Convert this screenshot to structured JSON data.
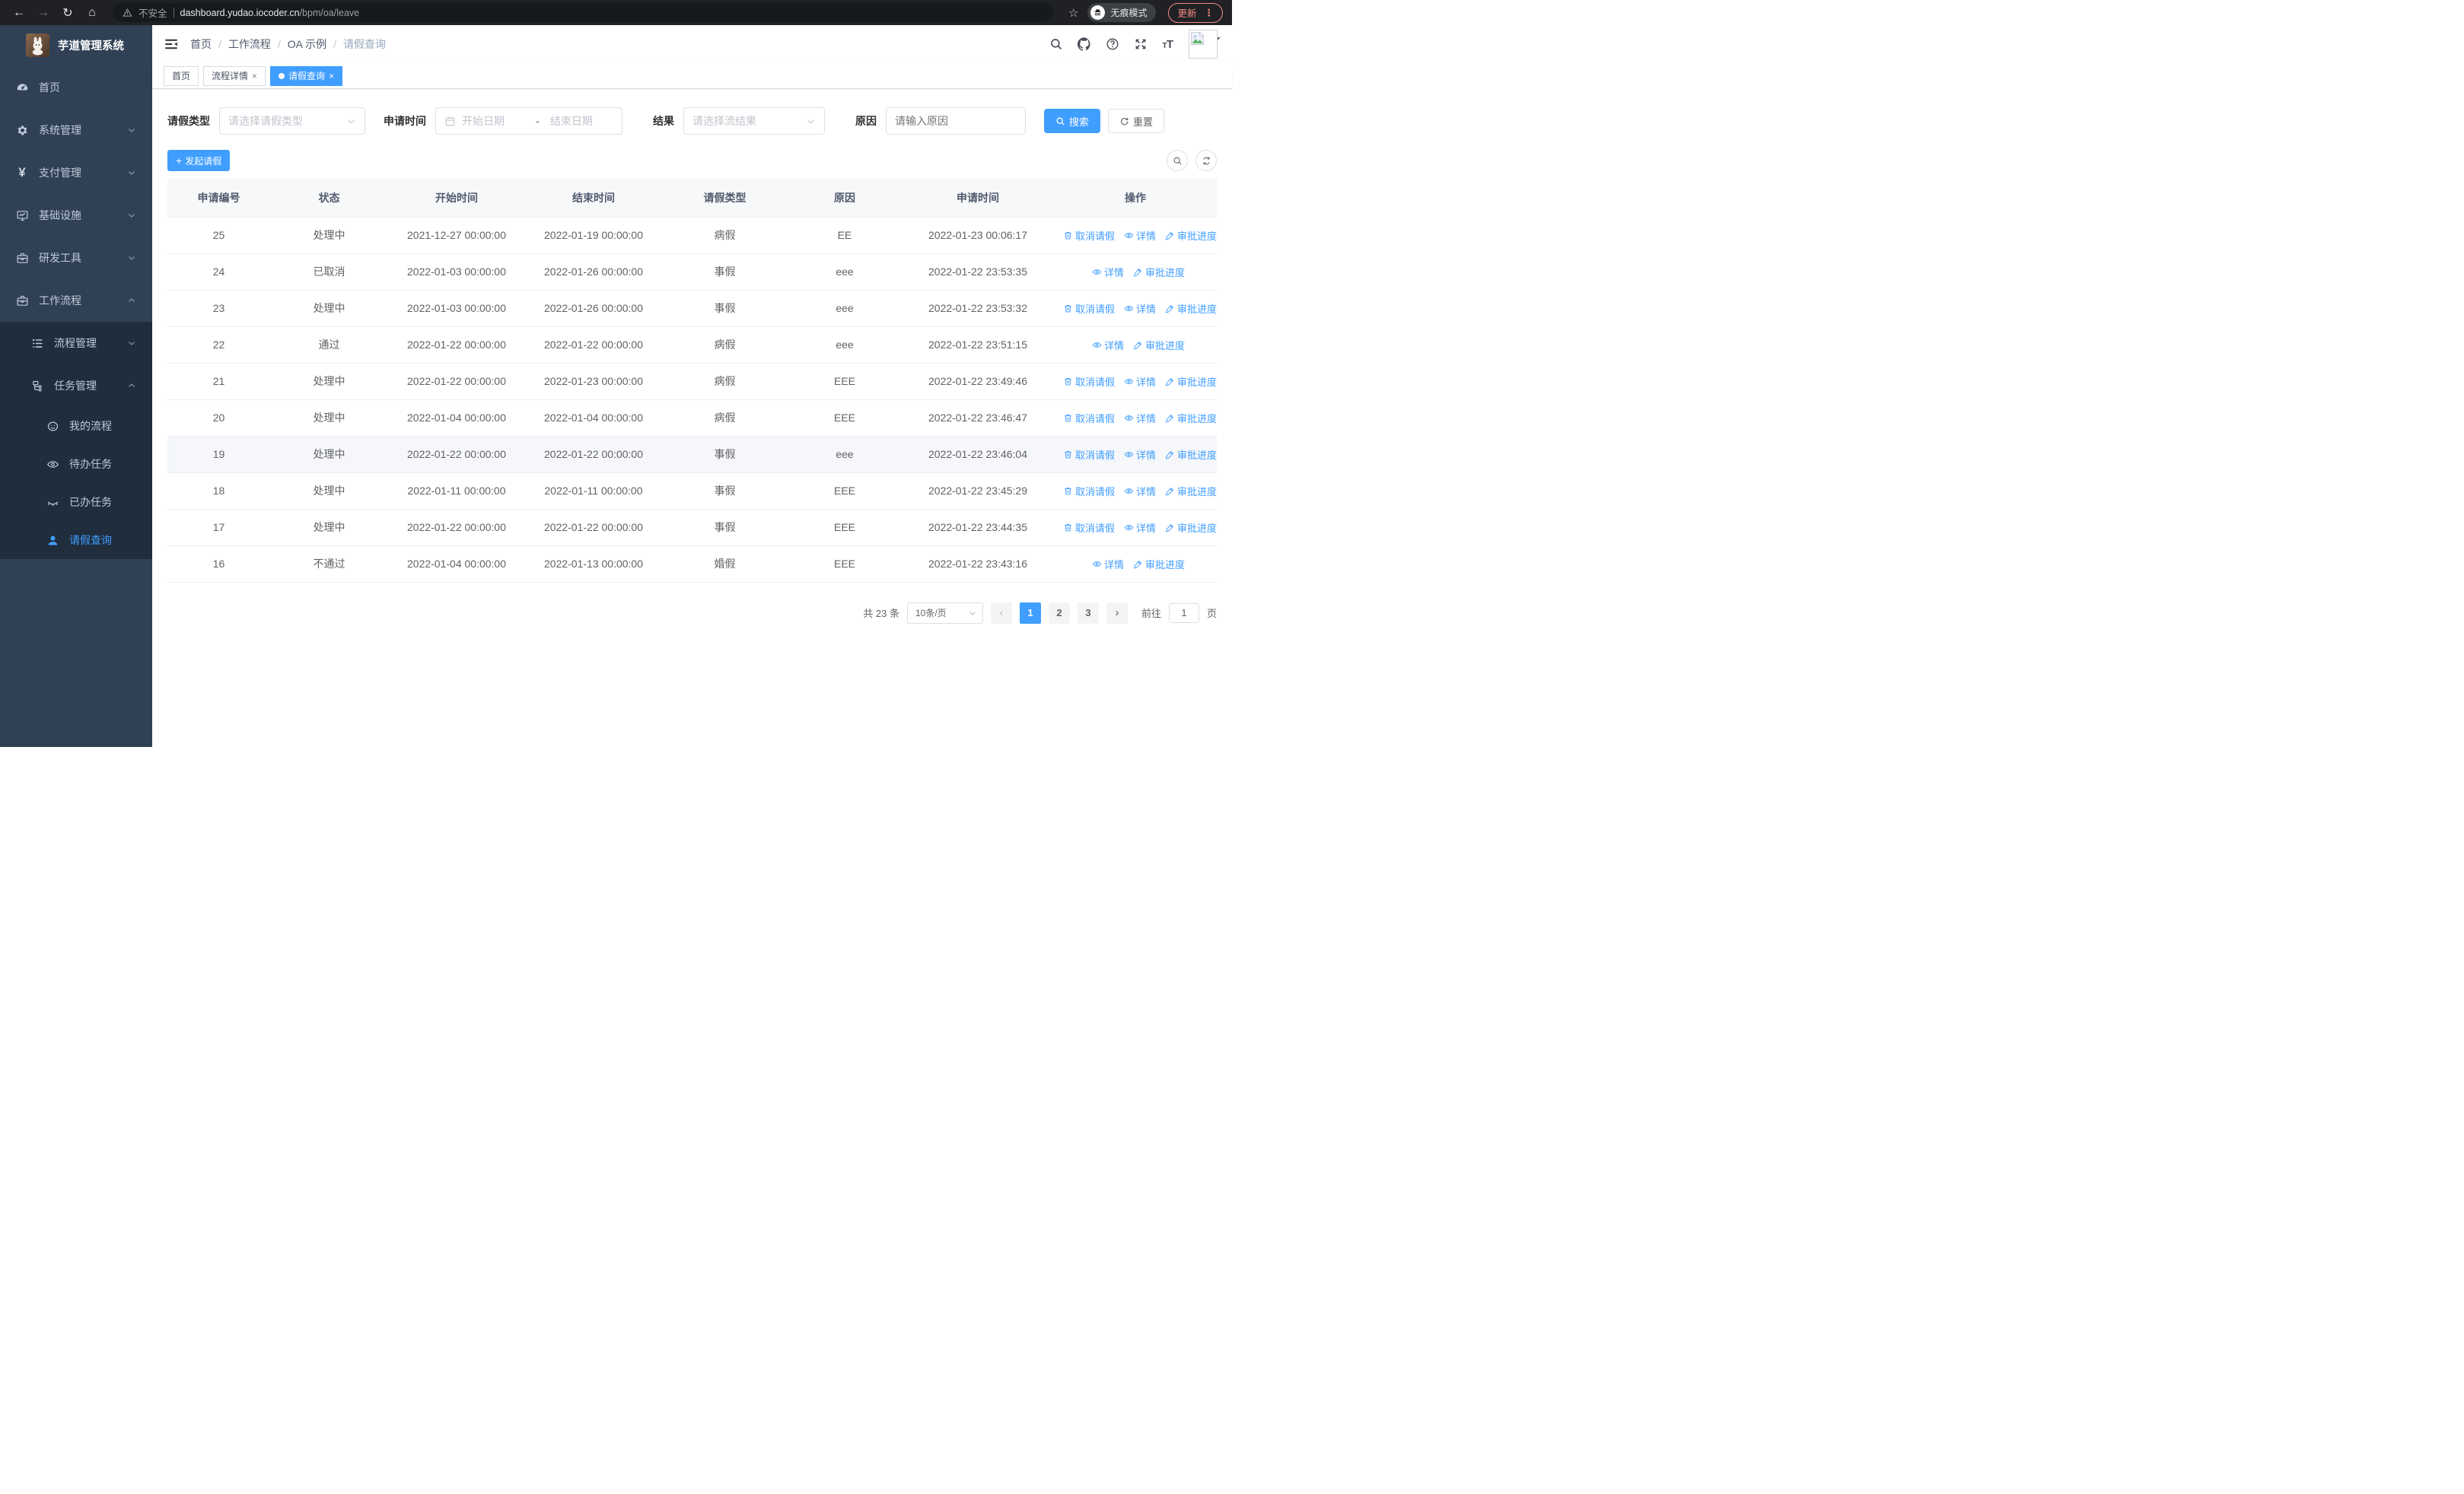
{
  "browser": {
    "security_label": "不安全",
    "url_host": "dashboard.yudao.iocoder.cn",
    "url_path": "/bpm/oa/leave",
    "incognito_label": "无痕模式",
    "update_label": "更新"
  },
  "sidebar": {
    "title": "芋道管理系统",
    "items": [
      {
        "label": "首页",
        "icon": "gauge-icon",
        "level": 1,
        "chevron": "",
        "sub": false,
        "active": false
      },
      {
        "label": "系统管理",
        "icon": "gear-icon",
        "level": 1,
        "chevron": "down",
        "sub": false,
        "active": false
      },
      {
        "label": "支付管理",
        "icon": "yen-icon",
        "level": 1,
        "chevron": "down",
        "sub": false,
        "active": false
      },
      {
        "label": "基础设施",
        "icon": "monitor-icon",
        "level": 1,
        "chevron": "down",
        "sub": false,
        "active": false
      },
      {
        "label": "研发工具",
        "icon": "briefcase-icon",
        "level": 1,
        "chevron": "down",
        "sub": false,
        "active": false
      },
      {
        "label": "工作流程",
        "icon": "briefcase-icon",
        "level": 1,
        "chevron": "up",
        "sub": false,
        "active": false
      },
      {
        "label": "流程管理",
        "icon": "tree-icon",
        "level": 2,
        "chevron": "down",
        "sub": true,
        "active": false
      },
      {
        "label": "任务管理",
        "icon": "flow-icon",
        "level": 2,
        "chevron": "up",
        "sub": true,
        "active": false
      },
      {
        "label": "我的流程",
        "icon": "face-icon",
        "level": 3,
        "chevron": "",
        "sub": true,
        "active": false
      },
      {
        "label": "待办任务",
        "icon": "eye-icon",
        "level": 3,
        "chevron": "",
        "sub": true,
        "active": false
      },
      {
        "label": "已办任务",
        "icon": "eye-closed-icon",
        "level": 3,
        "chevron": "",
        "sub": true,
        "active": false
      },
      {
        "label": "请假查询",
        "icon": "user-icon",
        "level": 3,
        "chevron": "",
        "sub": true,
        "active": true
      }
    ]
  },
  "header": {
    "breadcrumb": [
      "首页",
      "工作流程",
      "OA 示例",
      "请假查询"
    ]
  },
  "tabs": [
    {
      "label": "首页",
      "closable": false,
      "active": false
    },
    {
      "label": "流程详情",
      "closable": true,
      "active": false
    },
    {
      "label": "请假查询",
      "closable": true,
      "active": true
    }
  ],
  "filters": {
    "leave_type_label": "请假类型",
    "leave_type_placeholder": "请选择请假类型",
    "apply_time_label": "申请时间",
    "date_start_placeholder": "开始日期",
    "date_separator": "-",
    "date_end_placeholder": "结束日期",
    "result_label": "结果",
    "result_placeholder": "请选择流结果",
    "reason_label": "原因",
    "reason_placeholder": "请输入原因",
    "search_label": "搜索",
    "reset_label": "重置"
  },
  "toolbar": {
    "create_label": "发起请假"
  },
  "table": {
    "columns": [
      "申请编号",
      "状态",
      "开始时间",
      "结束时间",
      "请假类型",
      "原因",
      "申请时间",
      "操作"
    ],
    "action_labels": {
      "cancel": "取消请假",
      "detail": "详情",
      "progress": "审批进度"
    },
    "rows": [
      {
        "id": "25",
        "status": "处理中",
        "start": "2021-12-27 00:00:00",
        "end": "2022-01-19 00:00:00",
        "type": "病假",
        "reason": "EE",
        "applied": "2022-01-23 00:06:17",
        "actions": [
          "cancel",
          "detail",
          "progress"
        ],
        "highlight": false
      },
      {
        "id": "24",
        "status": "已取消",
        "start": "2022-01-03 00:00:00",
        "end": "2022-01-26 00:00:00",
        "type": "事假",
        "reason": "eee",
        "applied": "2022-01-22 23:53:35",
        "actions": [
          "detail",
          "progress"
        ],
        "highlight": false
      },
      {
        "id": "23",
        "status": "处理中",
        "start": "2022-01-03 00:00:00",
        "end": "2022-01-26 00:00:00",
        "type": "事假",
        "reason": "eee",
        "applied": "2022-01-22 23:53:32",
        "actions": [
          "cancel",
          "detail",
          "progress"
        ],
        "highlight": false
      },
      {
        "id": "22",
        "status": "通过",
        "start": "2022-01-22 00:00:00",
        "end": "2022-01-22 00:00:00",
        "type": "病假",
        "reason": "eee",
        "applied": "2022-01-22 23:51:15",
        "actions": [
          "detail",
          "progress"
        ],
        "highlight": false
      },
      {
        "id": "21",
        "status": "处理中",
        "start": "2022-01-22 00:00:00",
        "end": "2022-01-23 00:00:00",
        "type": "病假",
        "reason": "EEE",
        "applied": "2022-01-22 23:49:46",
        "actions": [
          "cancel",
          "detail",
          "progress"
        ],
        "highlight": false
      },
      {
        "id": "20",
        "status": "处理中",
        "start": "2022-01-04 00:00:00",
        "end": "2022-01-04 00:00:00",
        "type": "病假",
        "reason": "EEE",
        "applied": "2022-01-22 23:46:47",
        "actions": [
          "cancel",
          "detail",
          "progress"
        ],
        "highlight": false
      },
      {
        "id": "19",
        "status": "处理中",
        "start": "2022-01-22 00:00:00",
        "end": "2022-01-22 00:00:00",
        "type": "事假",
        "reason": "eee",
        "applied": "2022-01-22 23:46:04",
        "actions": [
          "cancel",
          "detail",
          "progress"
        ],
        "highlight": true
      },
      {
        "id": "18",
        "status": "处理中",
        "start": "2022-01-11 00:00:00",
        "end": "2022-01-11 00:00:00",
        "type": "事假",
        "reason": "EEE",
        "applied": "2022-01-22 23:45:29",
        "actions": [
          "cancel",
          "detail",
          "progress"
        ],
        "highlight": false
      },
      {
        "id": "17",
        "status": "处理中",
        "start": "2022-01-22 00:00:00",
        "end": "2022-01-22 00:00:00",
        "type": "事假",
        "reason": "EEE",
        "applied": "2022-01-22 23:44:35",
        "actions": [
          "cancel",
          "detail",
          "progress"
        ],
        "highlight": false
      },
      {
        "id": "16",
        "status": "不通过",
        "start": "2022-01-04 00:00:00",
        "end": "2022-01-13 00:00:00",
        "type": "婚假",
        "reason": "EEE",
        "applied": "2022-01-22 23:43:16",
        "actions": [
          "detail",
          "progress"
        ],
        "highlight": false
      }
    ]
  },
  "pagination": {
    "total_label": "共 23 条",
    "page_size": "10条/页",
    "pages": [
      "1",
      "2",
      "3"
    ],
    "active_page": "1",
    "prev_disabled": true,
    "goto_label": "前往",
    "goto_value": "1",
    "page_label": "页"
  },
  "colors": {
    "primary": "#409eff",
    "sidebar_bg": "#304156",
    "submenu_bg": "#1f2d3d"
  }
}
